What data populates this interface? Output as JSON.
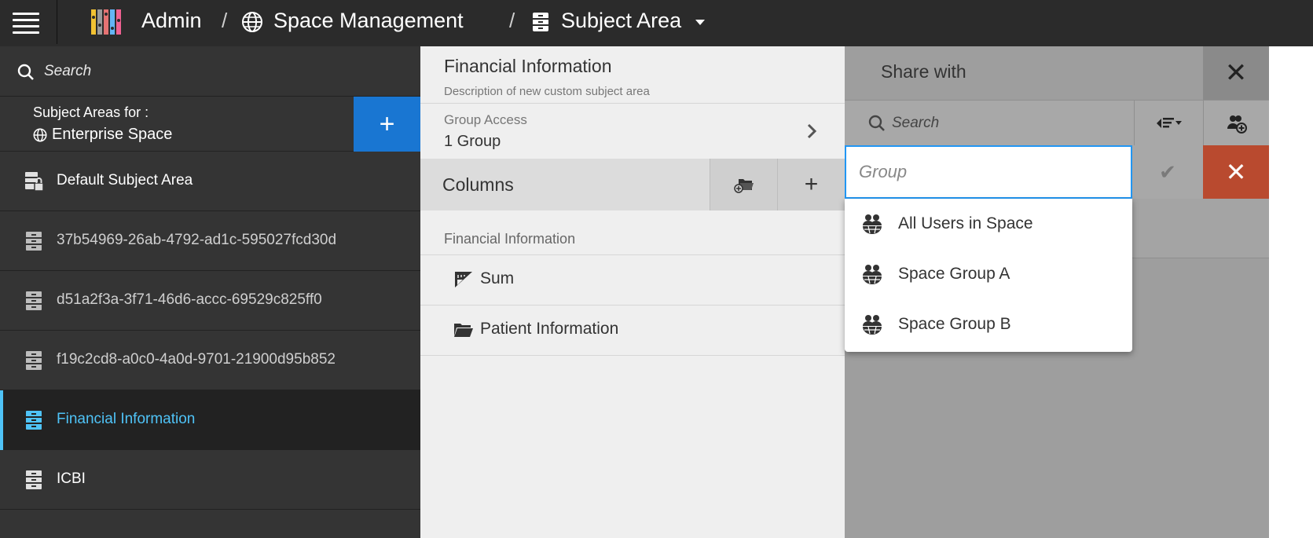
{
  "topbar": {
    "crumbs": [
      "Admin",
      "Space Management",
      "Subject Area"
    ],
    "separator": "/"
  },
  "sidebar": {
    "search_placeholder": "Search",
    "areas_for_label": "Subject Areas for :",
    "space_name": "Enterprise Space",
    "add_label": "+",
    "items": [
      {
        "label": "Default Subject Area",
        "icon": "locked-cabinet-icon"
      },
      {
        "label": "37b54969-26ab-4792-ad1c-595027fcd30d",
        "icon": "cabinet-icon"
      },
      {
        "label": "d51a2f3a-3f71-46d6-accc-69529c825ff0",
        "icon": "cabinet-icon"
      },
      {
        "label": "f19c2cd8-a0c0-4a0d-9701-21900d95b852",
        "icon": "cabinet-icon"
      },
      {
        "label": "Financial Information",
        "icon": "cabinet-icon",
        "active": true
      },
      {
        "label": "ICBI",
        "icon": "cabinet-icon"
      }
    ]
  },
  "middle": {
    "title": "Financial Information",
    "description": "Description of new custom subject area",
    "group_access_label": "Group Access",
    "group_access_value": "1 Group",
    "columns_title": "Columns",
    "add_label": "+",
    "section_label": "Financial Information",
    "rows": [
      {
        "label": "Sum",
        "icon": "measure-icon"
      },
      {
        "label": "Patient Information",
        "icon": "folder-open-icon"
      }
    ]
  },
  "share": {
    "title": "Share with",
    "search_placeholder": "Search",
    "group_placeholder": "Group",
    "close_label": "✕",
    "confirm_label": "✔",
    "cancel_label": "✕",
    "options": [
      {
        "label": "All Users in Space",
        "icon": "users-group-icon"
      },
      {
        "label": "Space Group A",
        "icon": "users-group-icon"
      },
      {
        "label": "Space Group B",
        "icon": "users-group-icon"
      }
    ]
  },
  "colors": {
    "topbar_bg": "#2b2b2b",
    "sidebar_bg": "#343434",
    "accent_blue": "#1976d2",
    "active_text": "#4fc3f7",
    "cancel_red": "#b94a2f"
  }
}
